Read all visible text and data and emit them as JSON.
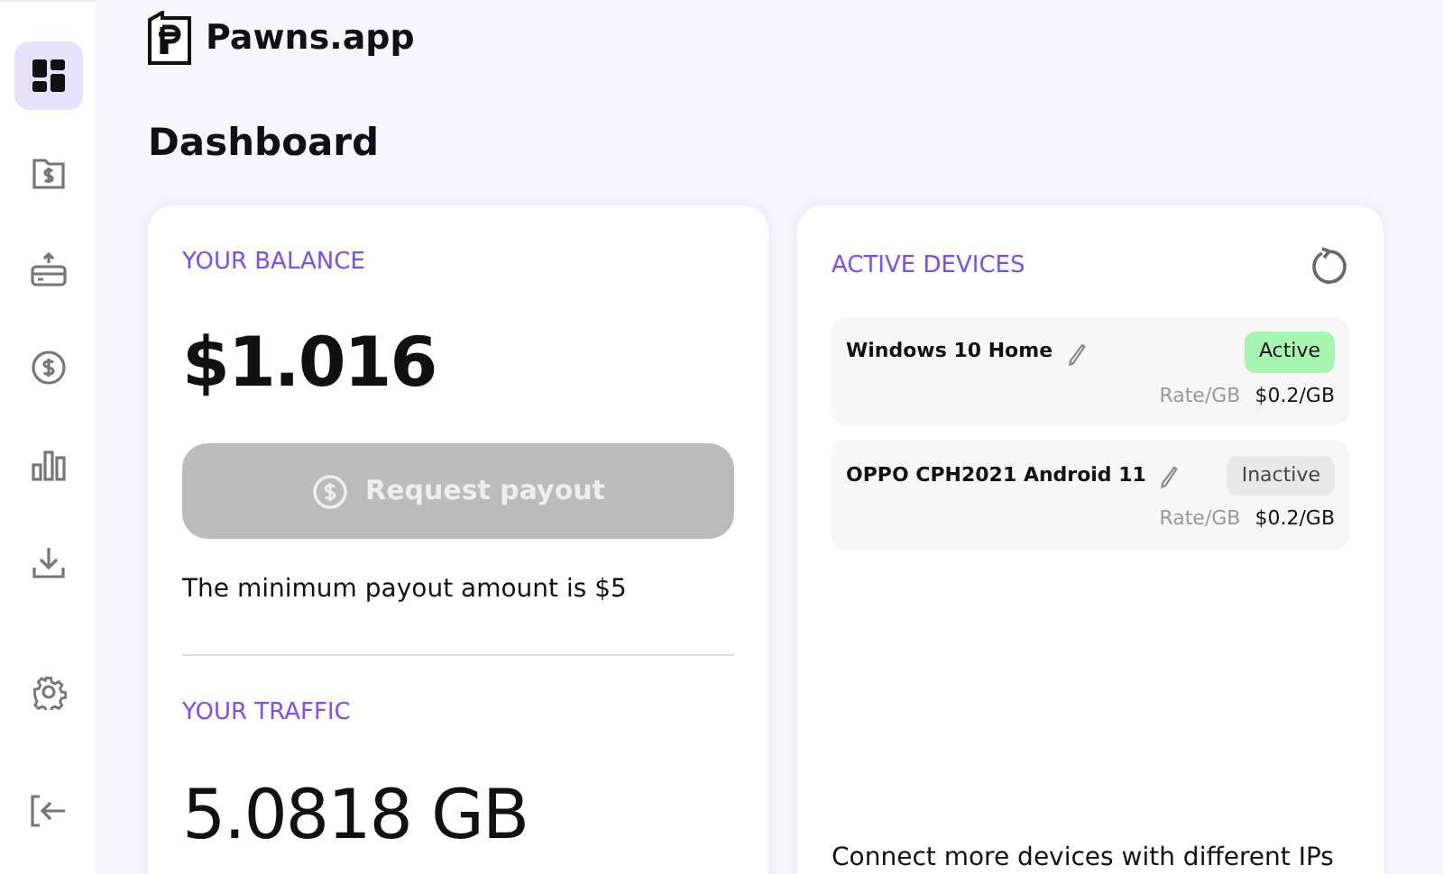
{
  "sidebar": {
    "items": [
      {
        "kind": "dashboard",
        "selected": true
      },
      {
        "kind": "folder",
        "selected": false
      },
      {
        "kind": "card",
        "selected": false
      },
      {
        "kind": "coin",
        "selected": false
      },
      {
        "kind": "chart",
        "selected": false
      },
      {
        "kind": "download",
        "selected": false
      }
    ],
    "bottom_items": [
      {
        "kind": "settings"
      },
      {
        "kind": "logout"
      }
    ]
  },
  "logo": {
    "text": "Pawns.app"
  },
  "page_title": "Dashboard",
  "balance": {
    "heading": "YOUR BALANCE",
    "amount": "$1.016",
    "button": {
      "label": "Request payout",
      "disabled": true
    },
    "note": "The minimum payout amount is $5"
  },
  "traffic": {
    "heading": "YOUR TRAFFIC",
    "amount": "5.0818 GB"
  },
  "devices": {
    "heading": "ACTIVE DEVICES",
    "items": [
      {
        "name": "Windows 10 Home",
        "status": "Active",
        "active": true,
        "rate_label": "Rate/GB",
        "rate": "$0.2/GB"
      },
      {
        "name": "OPPO CPH2021 Android 11",
        "status": "Inactive",
        "active": false,
        "rate_label": "Rate/GB",
        "rate": "$0.2/GB"
      }
    ],
    "footer": "Connect more devices with different IPs"
  }
}
